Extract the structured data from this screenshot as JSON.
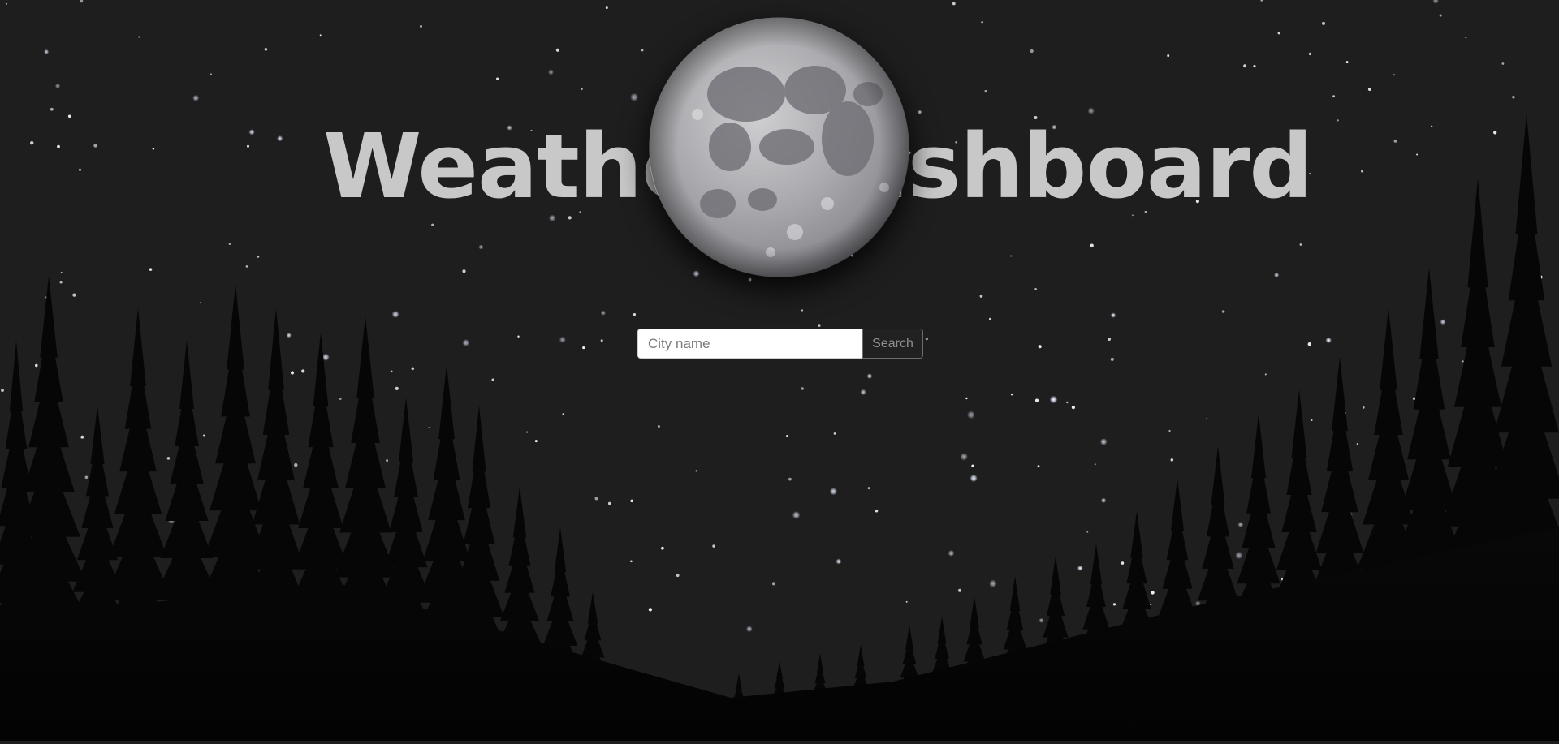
{
  "header": {
    "title": "Weather Dashboard"
  },
  "search": {
    "placeholder": "City name",
    "value": "",
    "button_label": "Search"
  },
  "theme": {
    "sky": "#1e1e1f",
    "title_color": "#c8c8c8",
    "tree_color": "#060606",
    "star_color": "#ffffff",
    "moon_color": "#9e9ea2"
  },
  "icons": {
    "moon": "full-moon-icon"
  }
}
